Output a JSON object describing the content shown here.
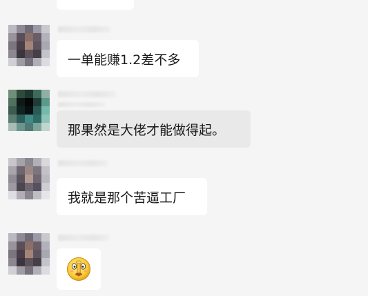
{
  "messages": [
    {
      "text": "一单能赚1.2差不多"
    },
    {
      "text": "那果然是大佬才能做得起。"
    },
    {
      "text": "我就是那个苦逼工厂"
    },
    {
      "emoji": "emoji-icon"
    }
  ]
}
